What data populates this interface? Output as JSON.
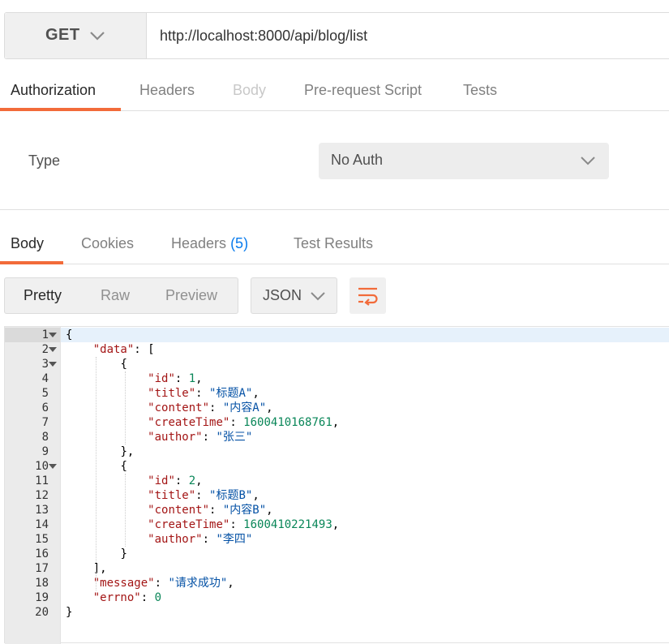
{
  "request": {
    "method": "GET",
    "url": "http://localhost:8000/api/blog/list"
  },
  "request_tabs": [
    {
      "label": "Authorization",
      "state": "active"
    },
    {
      "label": "Headers",
      "state": "normal"
    },
    {
      "label": "Body",
      "state": "disabled"
    },
    {
      "label": "Pre-request Script",
      "state": "normal"
    },
    {
      "label": "Tests",
      "state": "normal"
    }
  ],
  "auth": {
    "type_label": "Type",
    "type_value": "No Auth"
  },
  "response_tabs": {
    "body": "Body",
    "cookies": "Cookies",
    "headers": "Headers",
    "headers_count": "(5)",
    "tests": "Test Results"
  },
  "view_modes": [
    "Pretty",
    "Raw",
    "Preview"
  ],
  "format": "JSON",
  "icons": {
    "method_dropdown": "chevron-down-icon",
    "auth_dropdown": "chevron-down-icon",
    "format_dropdown": "chevron-down-icon",
    "wrap": "wrap-lines-icon"
  },
  "colors": {
    "accent": "#f26b3a",
    "link": "#097bed"
  },
  "editor": {
    "line_numbers": [
      "1",
      "2",
      "3",
      "4",
      "5",
      "6",
      "7",
      "8",
      "9",
      "10",
      "11",
      "12",
      "13",
      "14",
      "15",
      "16",
      "17",
      "18",
      "19",
      "20"
    ],
    "response_json": {
      "data": [
        {
          "id": 1,
          "title": "标题A",
          "content": "内容A",
          "createTime": 1600410168761,
          "author": "张三"
        },
        {
          "id": 2,
          "title": "标题B",
          "content": "内容B",
          "createTime": 1600410221493,
          "author": "李四"
        }
      ],
      "message": "请求成功",
      "errno": 0
    }
  }
}
